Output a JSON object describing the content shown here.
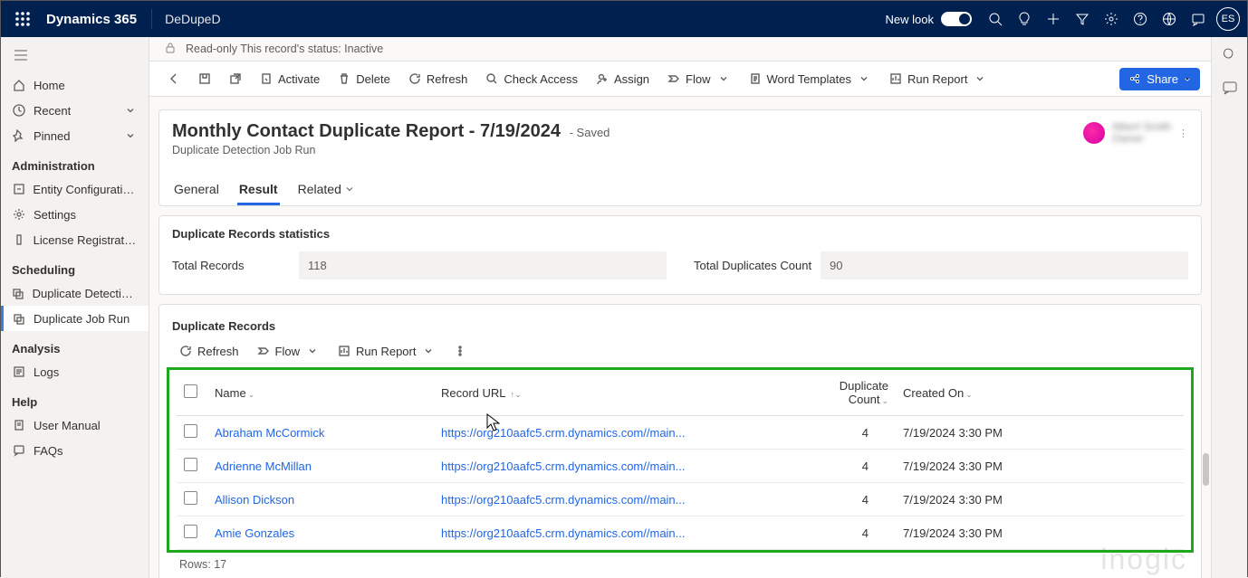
{
  "topbar": {
    "brand": "Dynamics 365",
    "app": "DeDupeD",
    "newlook": "New look",
    "avatar": "ES"
  },
  "readonly": "Read-only This record's status: Inactive",
  "cmds": {
    "activate": "Activate",
    "delete": "Delete",
    "refresh": "Refresh",
    "checkaccess": "Check Access",
    "assign": "Assign",
    "flow": "Flow",
    "word": "Word Templates",
    "runreport": "Run Report",
    "share": "Share"
  },
  "sidebar": {
    "home": "Home",
    "recent": "Recent",
    "pinned": "Pinned",
    "admin_hdr": "Administration",
    "entity": "Entity Configurations",
    "settings": "Settings",
    "license": "License Registration",
    "sched_hdr": "Scheduling",
    "dupdet": "Duplicate Detection ...",
    "dupjob": "Duplicate Job Run",
    "analysis_hdr": "Analysis",
    "logs": "Logs",
    "help_hdr": "Help",
    "manual": "User Manual",
    "faqs": "FAQs"
  },
  "header": {
    "title": "Monthly Contact Duplicate Report - 7/19/2024",
    "saved": "- Saved",
    "subtitle": "Duplicate Detection Job Run",
    "owner_name": "Albert Smith",
    "owner_role": "Owner"
  },
  "tabs": {
    "general": "General",
    "result": "Result",
    "related": "Related"
  },
  "stats": {
    "section": "Duplicate Records statistics",
    "total_label": "Total Records",
    "total_val": "118",
    "dup_label": "Total Duplicates Count",
    "dup_val": "90"
  },
  "duprec": {
    "title": "Duplicate Records",
    "refresh": "Refresh",
    "flow": "Flow",
    "runreport": "Run Report",
    "cols": {
      "name": "Name",
      "url": "Record URL",
      "count": "Duplicate Count",
      "created": "Created On"
    },
    "rows": [
      {
        "name": "Abraham McCormick",
        "url": "https://org210aafc5.crm.dynamics.com//main...",
        "count": "4",
        "created": "7/19/2024 3:30 PM"
      },
      {
        "name": "Adrienne McMillan",
        "url": "https://org210aafc5.crm.dynamics.com//main...",
        "count": "4",
        "created": "7/19/2024 3:30 PM"
      },
      {
        "name": "Allison Dickson",
        "url": "https://org210aafc5.crm.dynamics.com//main...",
        "count": "4",
        "created": "7/19/2024 3:30 PM"
      },
      {
        "name": "Amie Gonzales",
        "url": "https://org210aafc5.crm.dynamics.com//main...",
        "count": "4",
        "created": "7/19/2024 3:30 PM"
      }
    ],
    "footer": "Rows: 17"
  },
  "watermark": "inogic"
}
